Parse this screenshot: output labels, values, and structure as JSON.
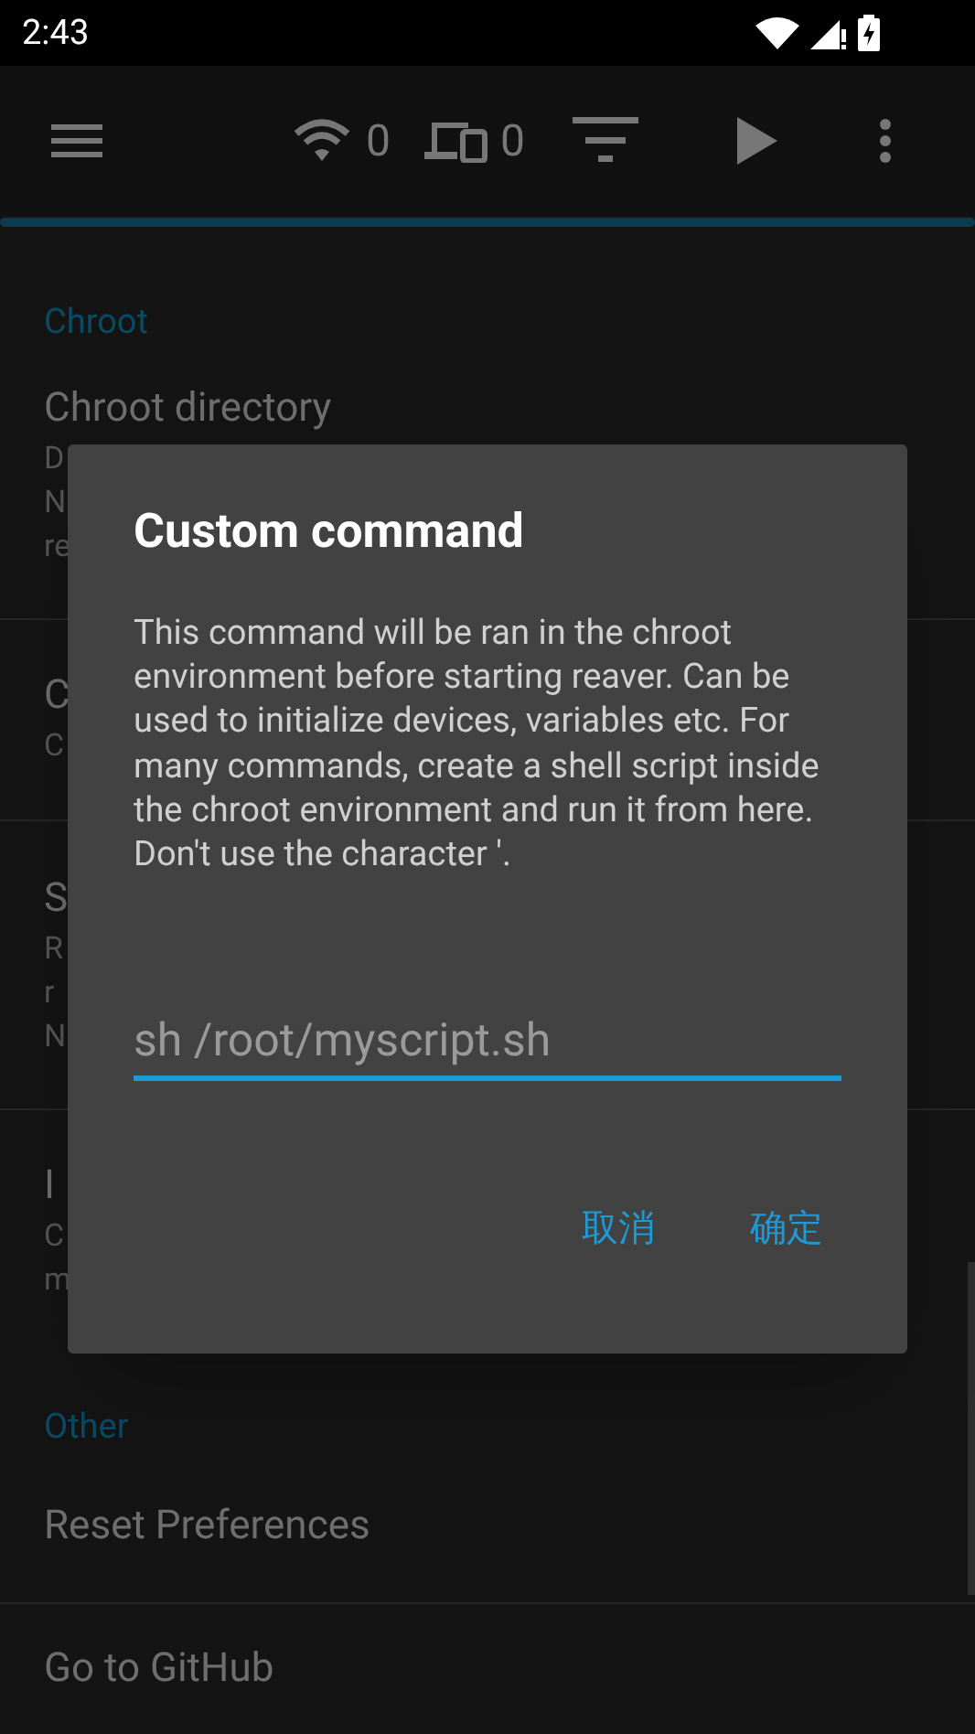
{
  "status_bar": {
    "time": "2:43"
  },
  "toolbar": {
    "wifi_count": "0",
    "devices_count": "0"
  },
  "sections": [
    {
      "header": "Chroot",
      "rows": [
        {
          "title": "Chroot directory",
          "lines": [
            "D",
            "N",
            "re"
          ]
        },
        {
          "title": "C",
          "lines": [
            "C"
          ]
        },
        {
          "title": "S",
          "lines": [
            "R",
            "r",
            "N"
          ]
        },
        {
          "title": "I",
          "lines": [
            "C",
            "m"
          ]
        }
      ]
    },
    {
      "header": "Other",
      "rows": [
        {
          "title": "Reset Preferences",
          "lines": []
        },
        {
          "title": "Go to GitHub",
          "lines": []
        }
      ]
    }
  ],
  "dialog": {
    "title": "Custom command",
    "message": "This command will be ran in the chroot environment before starting reaver. Can be used to initialize devices, variables etc. For many commands, create a shell script inside the chroot environment and run it from here. Don't use the character '.",
    "placeholder": "sh /root/myscript.sh",
    "buttons": [
      "取消",
      "确定"
    ]
  }
}
